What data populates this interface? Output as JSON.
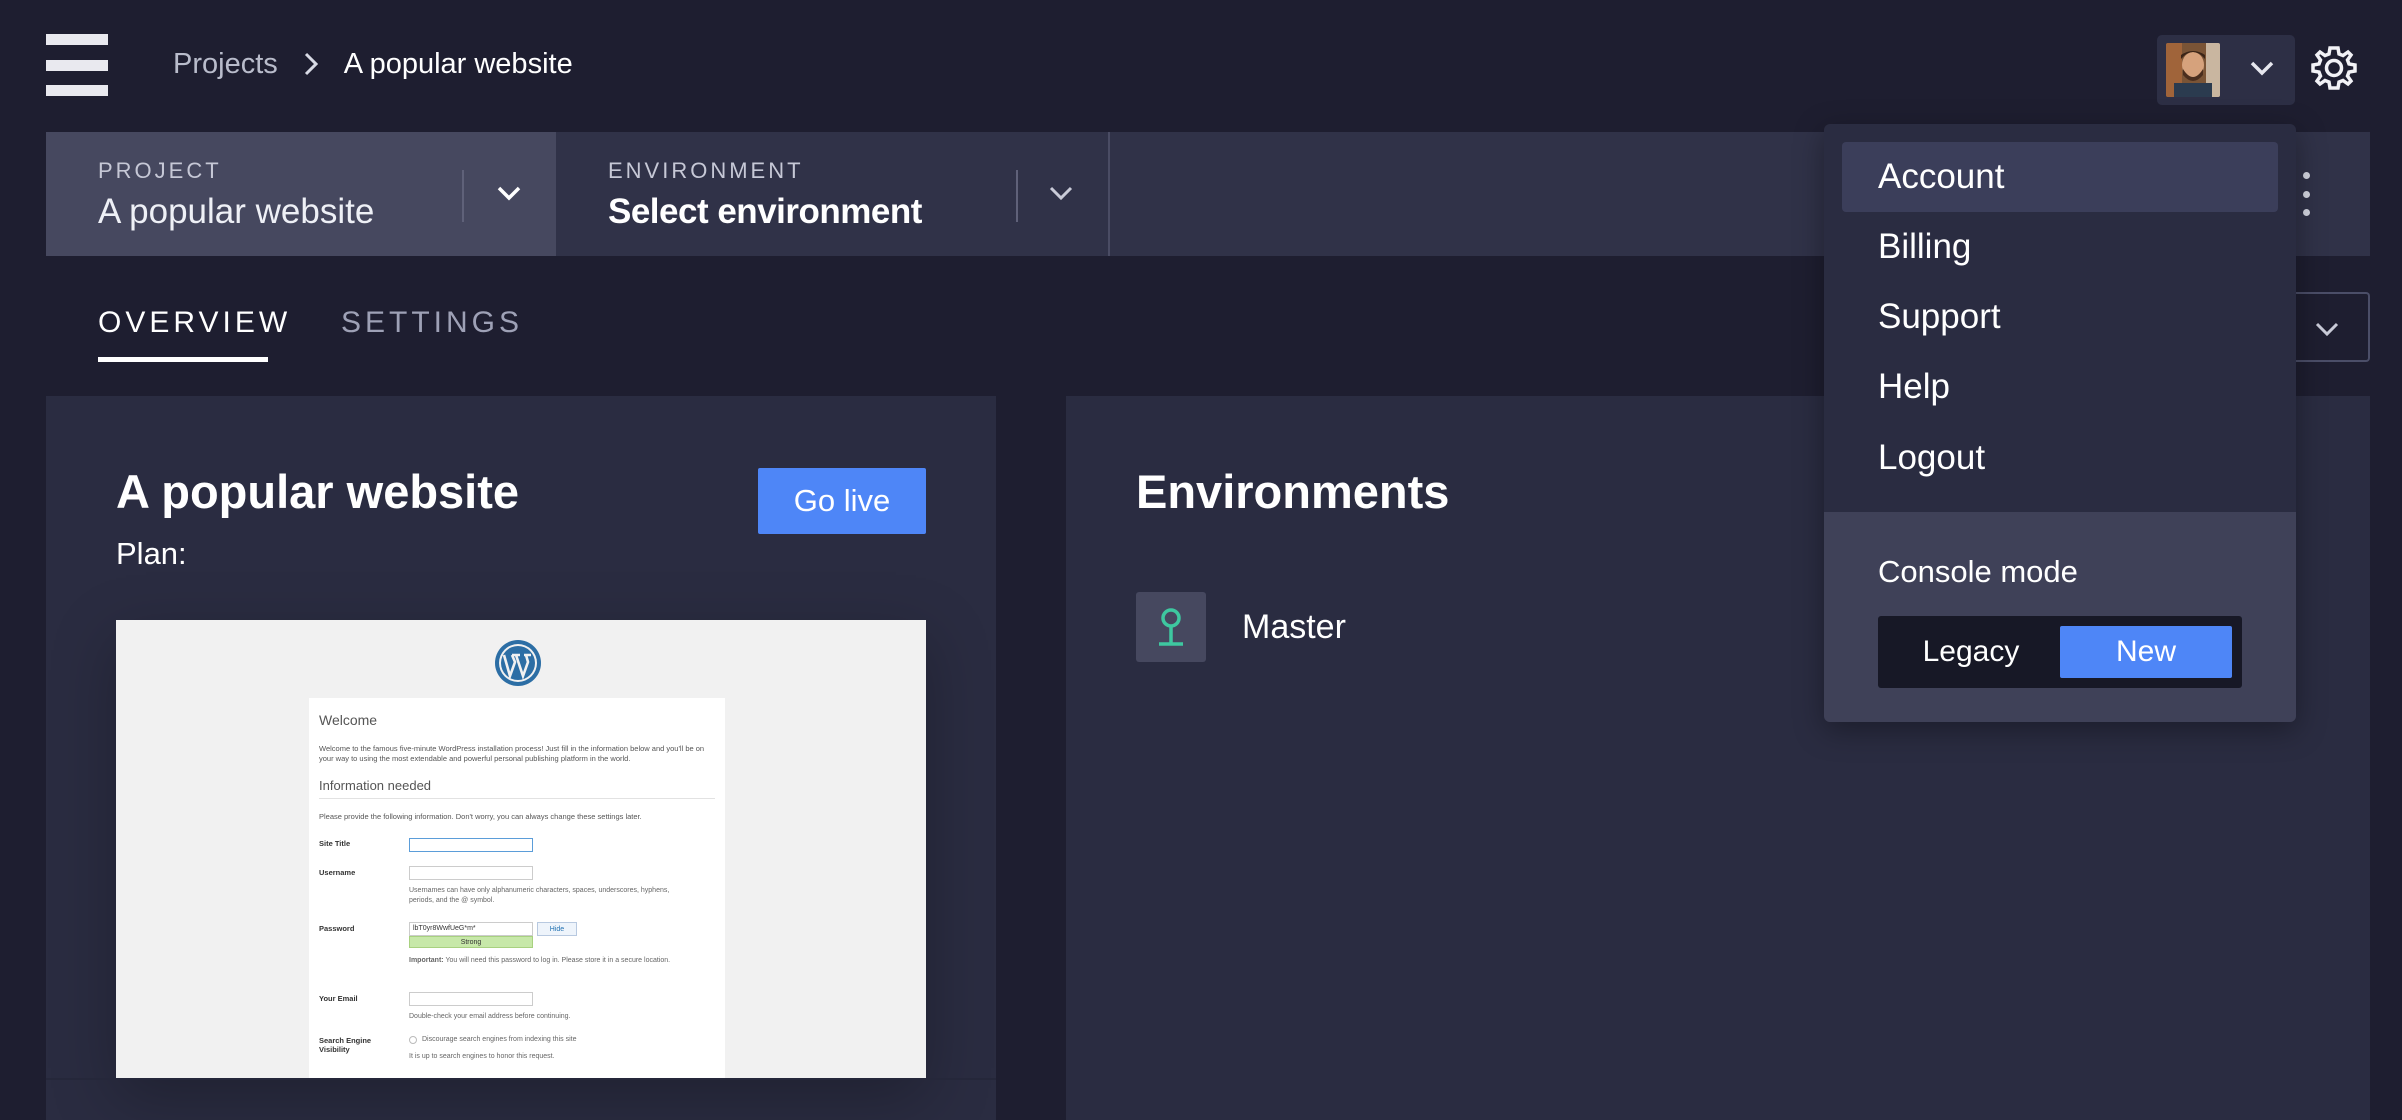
{
  "header": {
    "breadcrumb": [
      "Projects",
      "A popular website"
    ],
    "icons": {
      "logo": "menu-logo-icon",
      "user_menu": "chevron-down-icon",
      "settings": "gear-icon"
    }
  },
  "env_bar": {
    "project": {
      "label": "PROJECT",
      "value": "A popular website"
    },
    "environment": {
      "label": "ENVIRONMENT",
      "value": "Select environment"
    }
  },
  "tabs": [
    "OVERVIEW",
    "SETTINGS"
  ],
  "active_tab": "OVERVIEW",
  "project_card": {
    "title": "A popular website",
    "plan_label": "Plan:",
    "go_live_label": "Go live",
    "preview": {
      "welcome": "Welcome",
      "intro": "Welcome to the famous five-minute WordPress installation process! Just fill in the information below and you'll be on your way to using the most extendable and powerful personal publishing platform in the world.",
      "info_heading": "Information needed",
      "info_text": "Please provide the following information. Don't worry, you can always change these settings later.",
      "site_title_label": "Site Title",
      "username_label": "Username",
      "username_note": "Usernames can have only alphanumeric characters, spaces, underscores, hyphens, periods, and the @ symbol.",
      "password_label": "Password",
      "password_value": "lbT0yr8WwfUeG*m*",
      "hide_label": "Hide",
      "strength_label": "Strong",
      "password_note_bold": "Important:",
      "password_note": "You will need this password to log in. Please store it in a secure location.",
      "email_label": "Your Email",
      "email_note": "Double-check your email address before continuing.",
      "search_label": "Search Engine Visibility",
      "search_option": "Discourage search engines from indexing this site",
      "search_note": "It is up to search engines to honor this request."
    }
  },
  "environments_card": {
    "title": "Environments",
    "items": [
      {
        "name": "Master",
        "icon": "pin-icon"
      }
    ]
  },
  "user_dropdown": {
    "items": [
      "Account",
      "Billing",
      "Support",
      "Help",
      "Logout"
    ],
    "highlighted": "Account",
    "console_mode": {
      "label": "Console mode",
      "options": [
        "Legacy",
        "New"
      ],
      "selected": "New"
    }
  },
  "colors": {
    "background": "#1e1e30",
    "accent": "#4e86f7",
    "env_icon": "#3ec8a0"
  }
}
